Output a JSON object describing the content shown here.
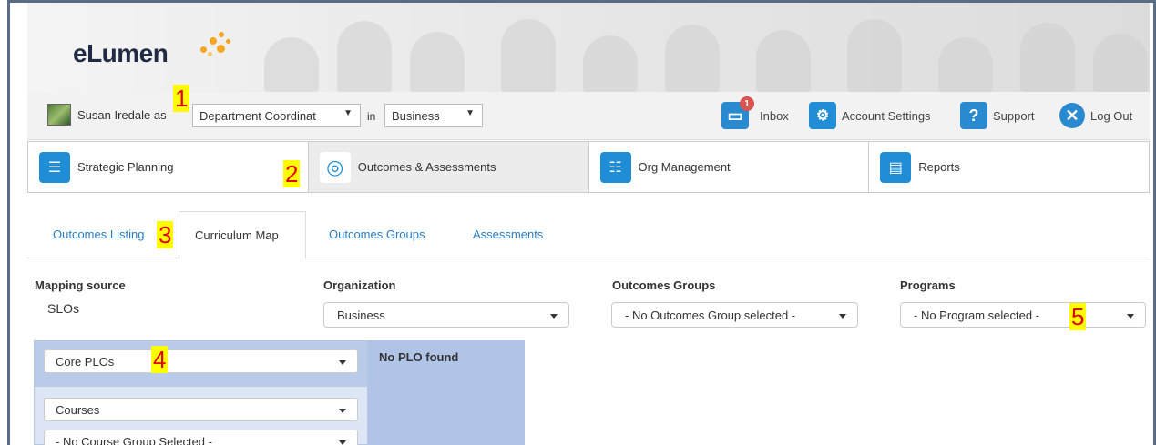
{
  "app": {
    "logo_text": "eLumen"
  },
  "user": {
    "name": "Susan Iredale",
    "as_label": "as",
    "role": "Department Coordinat",
    "in_label": "in",
    "org": "Business"
  },
  "top_actions": [
    {
      "label": "Inbox",
      "icon": "inbox-icon",
      "badge": "1"
    },
    {
      "label": "Account Settings",
      "icon": "gears-icon"
    },
    {
      "label": "Support",
      "icon": "question-icon"
    },
    {
      "label": "Log Out",
      "icon": "close-icon"
    }
  ],
  "modules": [
    {
      "label": "Strategic Planning",
      "icon": "strategic-planning-icon",
      "active": false
    },
    {
      "label": "Outcomes & Assessments",
      "icon": "target-icon",
      "active": true
    },
    {
      "label": "Org Management",
      "icon": "org-people-icon",
      "active": false
    },
    {
      "label": "Reports",
      "icon": "reports-icon",
      "active": false
    }
  ],
  "subtabs": [
    {
      "label": "Outcomes Listing",
      "active": false
    },
    {
      "label": "Curriculum Map",
      "active": true
    },
    {
      "label": "Outcomes Groups",
      "active": false
    },
    {
      "label": "Assessments",
      "active": false
    }
  ],
  "filters": {
    "mapping_source_label": "Mapping source",
    "mapping_source_value": "SLOs",
    "organization_label": "Organization",
    "organization_value": "Business",
    "outcomes_groups_label": "Outcomes Groups",
    "outcomes_groups_value": "- No Outcomes Group selected -",
    "programs_label": "Programs",
    "programs_value": "- No Program selected -"
  },
  "mapping": {
    "plo_select": "Core PLOs",
    "courses_select": "Courses",
    "course_group_select": "- No Course Group Selected -",
    "no_plo_text": "No PLO found"
  },
  "markers": [
    "1",
    "2",
    "3",
    "4",
    "5"
  ],
  "colors": {
    "accent": "#2a7dc4",
    "icon_blue": "#1f8ed6",
    "marker_bg": "#ffff00",
    "marker_text": "#e00000"
  }
}
